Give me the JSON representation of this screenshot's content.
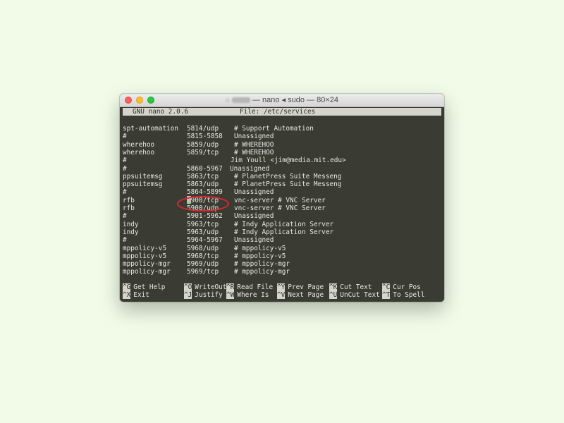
{
  "window": {
    "title_suffix": "— nano ◂ sudo — 80×24",
    "icon": "home-folder-icon"
  },
  "nano": {
    "version": "GNU nano 2.0.6",
    "file": "File: /etc/services"
  },
  "lines": [
    {
      "name": "spt-automation",
      "port": "5814/udp",
      "desc": "# Support Automation"
    },
    {
      "name": "#",
      "port": "5815-5858",
      "desc": "Unassigned"
    },
    {
      "name": "wherehoo",
      "port": "5859/udp",
      "desc": "# WHEREHOO"
    },
    {
      "name": "wherehoo",
      "port": "5859/tcp",
      "desc": "# WHEREHOO"
    },
    {
      "name": "#",
      "port": "",
      "desc": "Jim Youll <jim@media.mit.edu>"
    },
    {
      "name": "#",
      "port": "5860-5967",
      "desc": "Unassigned"
    },
    {
      "name": "ppsuitemsg",
      "port": "5863/tcp",
      "desc": "# PlanetPress Suite Messeng"
    },
    {
      "name": "ppsuitemsg",
      "port": "5863/udp",
      "desc": "# PlanetPress Suite Messeng"
    },
    {
      "name": "#",
      "port": "5864-5899",
      "desc": "Unassigned"
    },
    {
      "name": "rfb",
      "port": "5900/tcp",
      "desc": "vnc-server # VNC Server"
    },
    {
      "name": "rfb",
      "port": "5900/udp",
      "desc": "vnc-server # VNC Server"
    },
    {
      "name": "#",
      "port": "5901-5962",
      "desc": "Unassigned"
    },
    {
      "name": "indy",
      "port": "5963/tcp",
      "desc": "# Indy Application Server"
    },
    {
      "name": "indy",
      "port": "5963/udp",
      "desc": "# Indy Application Server"
    },
    {
      "name": "#",
      "port": "5964-5967",
      "desc": "Unassigned"
    },
    {
      "name": "mppolicy-v5",
      "port": "5968/udp",
      "desc": "# mppolicy-v5"
    },
    {
      "name": "mppolicy-v5",
      "port": "5968/tcp",
      "desc": "# mppolicy-v5"
    },
    {
      "name": "mppolicy-mgr",
      "port": "5969/udp",
      "desc": "# mppolicy-mgr"
    },
    {
      "name": "mppolicy-mgr",
      "port": "5969/tcp",
      "desc": "# mppolicy-mgr"
    }
  ],
  "shortcuts_row1": [
    {
      "key": "^G",
      "label": "Get Help"
    },
    {
      "key": "^O",
      "label": "WriteOut"
    },
    {
      "key": "^R",
      "label": "Read File"
    },
    {
      "key": "^Y",
      "label": "Prev Page"
    },
    {
      "key": "^K",
      "label": "Cut Text"
    },
    {
      "key": "^C",
      "label": "Cur Pos"
    }
  ],
  "shortcuts_row2": [
    {
      "key": "^X",
      "label": "Exit"
    },
    {
      "key": "^J",
      "label": "Justify"
    },
    {
      "key": "^W",
      "label": "Where Is"
    },
    {
      "key": "^V",
      "label": "Next Page"
    },
    {
      "key": "^U",
      "label": "UnCut Text"
    },
    {
      "key": "^T",
      "label": "To Spell"
    }
  ],
  "colors": {
    "terminal_bg": "#3a3c34",
    "text": "#e8e8e0",
    "highlight_bar": "#d5d5cc",
    "annotation_ring": "#e3262c",
    "page_bg": "#f1fbe8"
  }
}
